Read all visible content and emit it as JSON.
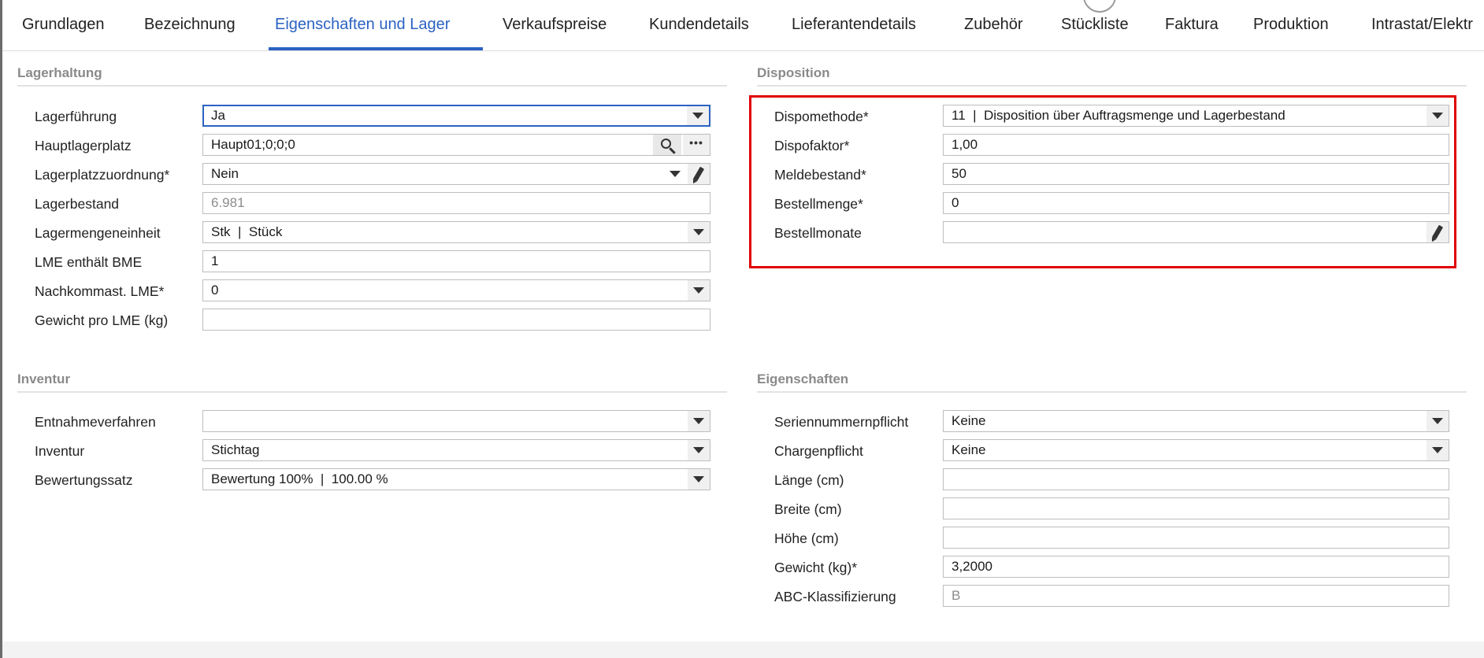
{
  "tabs": [
    {
      "label": "Grundlagen"
    },
    {
      "label": "Bezeichnung"
    },
    {
      "label": "Eigenschaften und Lager"
    },
    {
      "label": "Verkaufspreise"
    },
    {
      "label": "Kundendetails"
    },
    {
      "label": "Lieferantendetails"
    },
    {
      "label": "Zubehör"
    },
    {
      "label": "Stückliste"
    },
    {
      "label": "Faktura"
    },
    {
      "label": "Produktion"
    },
    {
      "label": "Intrastat/Elektr"
    }
  ],
  "active_tab": "Eigenschaften und Lager",
  "lagerhaltung": {
    "title": "Lagerhaltung",
    "rows": [
      {
        "label": "Lagerführung",
        "value": "Ja"
      },
      {
        "label": "Hauptlagerplatz",
        "value": "Haupt01;0;0;0"
      },
      {
        "label": "Lagerplatzzuordnung*",
        "value": "Nein"
      },
      {
        "label": "Lagerbestand",
        "value": "6.981"
      },
      {
        "label": "Lagermengeneinheit",
        "value": "Stk  |  Stück"
      },
      {
        "label": "LME enthält BME",
        "value": "1"
      },
      {
        "label": "Nachkommast. LME*",
        "value": "0"
      },
      {
        "label": "Gewicht pro LME (kg)",
        "value": ""
      }
    ]
  },
  "disposition": {
    "title": "Disposition",
    "rows": [
      {
        "label": "Dispomethode*",
        "value": "11  |  Disposition über Auftragsmenge und Lagerbestand"
      },
      {
        "label": "Dispofaktor*",
        "value": "1,00"
      },
      {
        "label": "Meldebestand*",
        "value": "50"
      },
      {
        "label": "Bestellmenge*",
        "value": "0"
      },
      {
        "label": "Bestellmonate",
        "value": ""
      }
    ]
  },
  "inventur": {
    "title": "Inventur",
    "rows": [
      {
        "label": "Entnahmeverfahren",
        "value": ""
      },
      {
        "label": "Inventur",
        "value": "Stichtag"
      },
      {
        "label": "Bewertungssatz",
        "value": "Bewertung 100%  |  100.00 %"
      }
    ]
  },
  "eigenschaften": {
    "title": "Eigenschaften",
    "rows": [
      {
        "label": "Seriennummernpflicht",
        "value": "Keine"
      },
      {
        "label": "Chargenpflicht",
        "value": "Keine"
      },
      {
        "label": "Länge (cm)",
        "value": ""
      },
      {
        "label": "Breite (cm)",
        "value": ""
      },
      {
        "label": "Höhe (cm)",
        "value": ""
      },
      {
        "label": "Gewicht (kg)*",
        "value": "3,2000"
      },
      {
        "label": "ABC-Klassifizierung",
        "value": "B"
      }
    ]
  },
  "colors": {
    "accent": "#2b62c3",
    "highlight": "#e00000"
  }
}
